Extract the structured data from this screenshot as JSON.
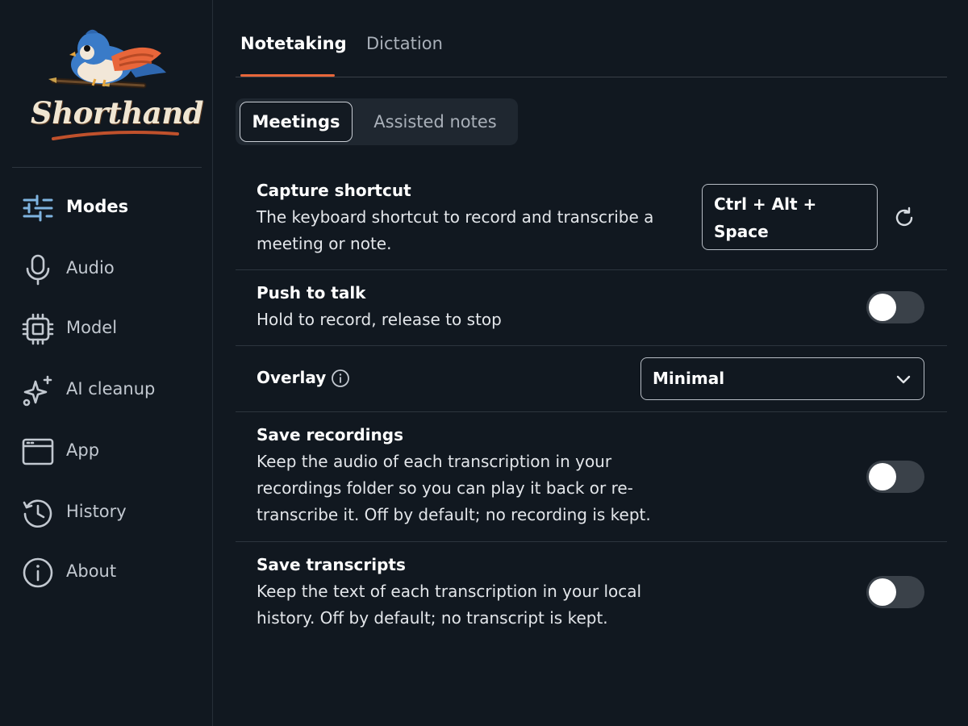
{
  "app": {
    "name": "Shorthand"
  },
  "sidebar": {
    "items": [
      {
        "label": "Modes",
        "icon": "sliders-icon",
        "active": true
      },
      {
        "label": "Audio",
        "icon": "microphone-icon",
        "active": false
      },
      {
        "label": "Model",
        "icon": "chip-icon",
        "active": false
      },
      {
        "label": "AI cleanup",
        "icon": "sparkle-icon",
        "active": false
      },
      {
        "label": "App",
        "icon": "window-icon",
        "active": false
      },
      {
        "label": "History",
        "icon": "history-icon",
        "active": false
      },
      {
        "label": "About",
        "icon": "info-icon",
        "active": false
      }
    ]
  },
  "tabs": [
    {
      "label": "Notetaking",
      "active": true
    },
    {
      "label": "Dictation",
      "active": false
    }
  ],
  "segmented": {
    "options": [
      {
        "label": "Meetings",
        "active": true
      },
      {
        "label": "Assisted notes",
        "active": false
      }
    ]
  },
  "settings": {
    "capture_shortcut": {
      "title": "Capture shortcut",
      "description_line1": "The keyboard shortcut to record and transcribe a",
      "description_line2": "meeting or note.",
      "value_line1": "Ctrl + Alt +",
      "value_line2": "Space"
    },
    "push_to_talk": {
      "title": "Push to talk",
      "description": "Hold to record, release to stop",
      "enabled": false
    },
    "overlay": {
      "title": "Overlay",
      "selected": "Minimal"
    },
    "save_recordings": {
      "title": "Save recordings",
      "description_line1": "Keep the audio of each transcription in your",
      "description_line2": "recordings folder so you can play it back or re-",
      "description_line3": "transcribe it. Off by default; no recording is kept.",
      "enabled": false
    },
    "save_transcripts": {
      "title": "Save transcripts",
      "description_line1": "Keep the text of each transcription in your local",
      "description_line2": "history. Off by default; no transcript is kept.",
      "enabled": false
    }
  },
  "colors": {
    "background": "#111820",
    "accent": "#e8663a",
    "icon_active": "#7fb4e0",
    "icon_inactive": "#c2c8d0",
    "toggle_off": "#3a4149"
  }
}
